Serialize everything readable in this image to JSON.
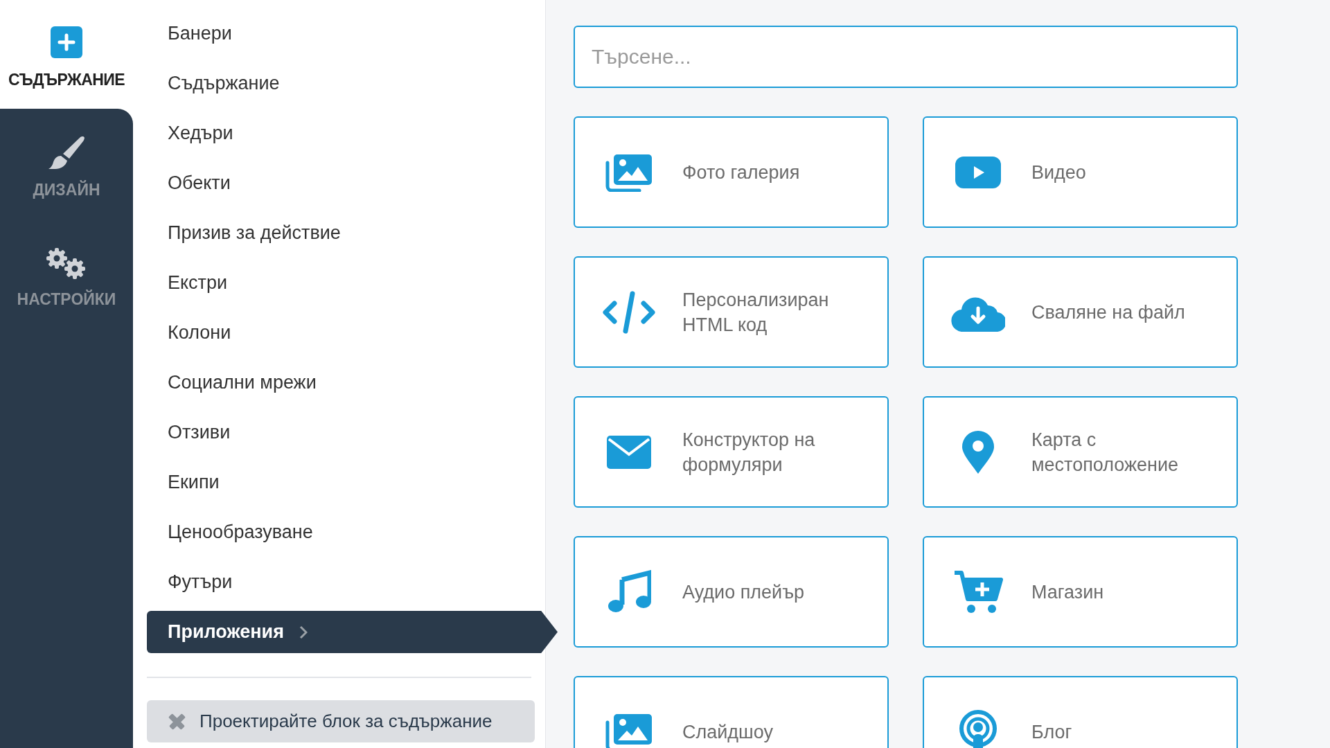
{
  "rail": [
    {
      "label": "СЪДЪРЖАНИЕ",
      "selected": true
    },
    {
      "label": "ДИЗАЙН",
      "selected": false
    },
    {
      "label": "НАСТРОЙКИ",
      "selected": false
    }
  ],
  "menu": [
    {
      "label": "Банери",
      "selected": false
    },
    {
      "label": "Съдържание",
      "selected": false
    },
    {
      "label": "Хедъри",
      "selected": false
    },
    {
      "label": "Обекти",
      "selected": false
    },
    {
      "label": "Призив за действие",
      "selected": false
    },
    {
      "label": "Екстри",
      "selected": false
    },
    {
      "label": "Колони",
      "selected": false
    },
    {
      "label": "Социални мрежи",
      "selected": false
    },
    {
      "label": "Отзиви",
      "selected": false
    },
    {
      "label": "Екипи",
      "selected": false
    },
    {
      "label": "Ценообразуване",
      "selected": false
    },
    {
      "label": "Футъри",
      "selected": false
    },
    {
      "label": "Приложения",
      "selected": true
    }
  ],
  "design_button": "Проектирайте блок за съдържание",
  "search": {
    "placeholder": "Търсене..."
  },
  "apps": [
    {
      "label": "Фото галерия"
    },
    {
      "label": "Видео"
    },
    {
      "label": "Персонализиран HTML код"
    },
    {
      "label": "Сваляне на файл"
    },
    {
      "label": "Конструктор на формуляри"
    },
    {
      "label": "Карта с местоположение"
    },
    {
      "label": "Аудио плейър"
    },
    {
      "label": "Магазин"
    },
    {
      "label": "Слайдшоу"
    },
    {
      "label": "Блог"
    }
  ]
}
